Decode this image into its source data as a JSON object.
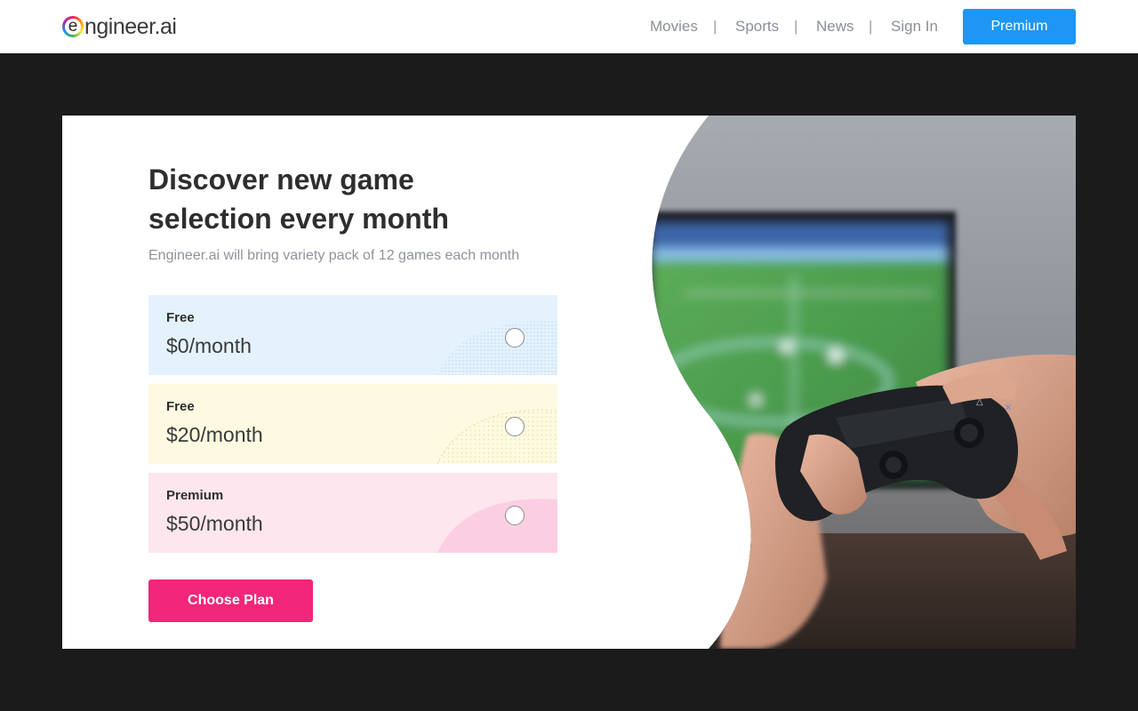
{
  "header": {
    "logo": {
      "icon_letter": "e",
      "text": "ngineer.ai"
    },
    "nav": [
      {
        "label": "Movies"
      },
      {
        "label": "Sports"
      },
      {
        "label": "News"
      },
      {
        "label": "Sign In"
      }
    ],
    "separator": "|",
    "premium_button": "Premium"
  },
  "hero": {
    "headline": "Discover new game selection every month",
    "subtitle": "Engineer.ai will bring variety pack of 12 games each month",
    "plans": [
      {
        "name": "Free",
        "price": "$0/month",
        "selected": false,
        "color": "#e4f2fd"
      },
      {
        "name": "Free",
        "price": "$20/month",
        "selected": false,
        "color": "#fdfae1"
      },
      {
        "name": "Premium",
        "price": "$50/month",
        "selected": false,
        "color": "#fde6ee"
      }
    ],
    "cta_button": "Choose Plan",
    "image": "gamepad-controller-playing-football-game"
  },
  "colors": {
    "accent_blue": "#1e96f3",
    "accent_pink": "#f2267a",
    "page_background": "#1b1b1b"
  }
}
